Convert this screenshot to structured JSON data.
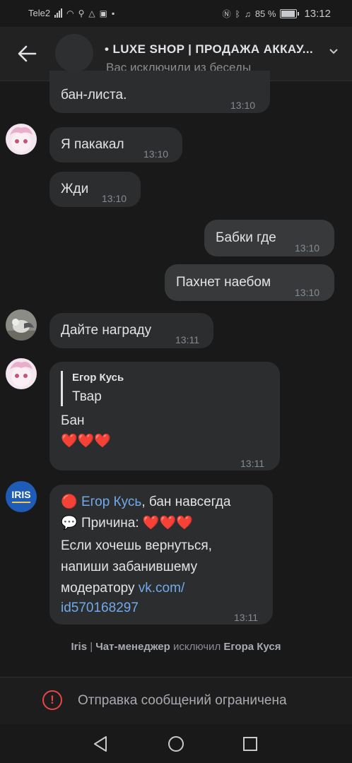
{
  "status": {
    "carrier": "Tele2",
    "battery": "85 %",
    "time": "13:12",
    "icons": [
      "signal-icon",
      "wifi-icon",
      "search-icon",
      "warning-icon",
      "image-icon",
      "notification-icon",
      "nfc-icon",
      "bluetooth-icon",
      "mute-icon",
      "battery-icon"
    ]
  },
  "header": {
    "title": "• LUXE SHOP | ПРОДАЖА АККАУ...",
    "subtitle": "Вас исключили из беседы"
  },
  "messages": [
    {
      "text": "бан-листа.",
      "time": "13:10"
    },
    {
      "text": "Я пакакал",
      "time": "13:10"
    },
    {
      "text": "Жди",
      "time": "13:10"
    },
    {
      "text": "Бабки где",
      "time": "13:10"
    },
    {
      "text": "Пахнет наебом",
      "time": "13:10"
    },
    {
      "text": "Дайте награду",
      "time": "13:11"
    }
  ],
  "reply_message": {
    "reply_author": "Егор Кусь",
    "reply_text": "Твар",
    "text": "Бан",
    "hearts": "❤️❤️❤️",
    "time": "13:11"
  },
  "bot_message": {
    "line1_icon": "🔴",
    "line1_name": "Егор Кусь",
    "line1_rest": ", бан навсегда",
    "line2_icon": "💬",
    "line2_text": "Причина:",
    "line2_hearts": "❤️❤️❤️",
    "line3": "Если хочешь вернуться,",
    "line4": "напиши забанившему",
    "line5_text": "модератору ",
    "line5_link": "vk.com/",
    "line6_link": "id570168297",
    "time": "13:11",
    "avatar_text": "IRIS"
  },
  "system": {
    "actor": "Iris",
    "sep": " | ",
    "role": "Чат-менеджер",
    "action": " исключил ",
    "target": "Егора Куся"
  },
  "restricted": {
    "text": "Отправка сообщений ограничена"
  },
  "colors": {
    "background": "#19191a",
    "bubble": "#2c2d2e",
    "link": "#71aaeb",
    "warning": "#e64646"
  }
}
